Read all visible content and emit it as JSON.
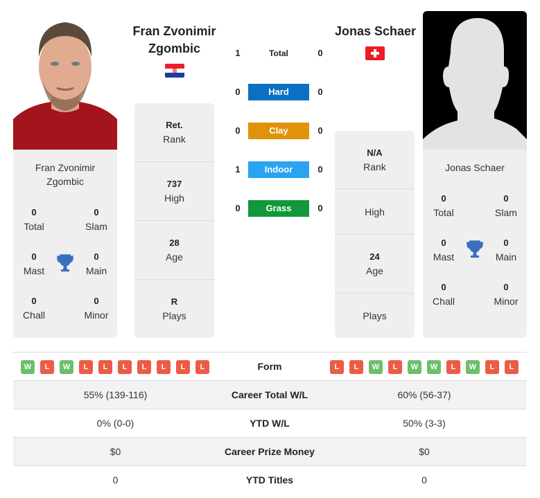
{
  "player_left": {
    "name_line1": "Fran Zvonimir",
    "name_line2": "Zgombic",
    "country": "Croatia",
    "flag_icon": "flag-croatia",
    "titles": {
      "total": "0",
      "slam": "0",
      "mast": "0",
      "main": "0",
      "chall": "0",
      "minor": "0"
    },
    "stats": {
      "rank_value": "Ret.",
      "rank_label": "Rank",
      "high_value": "737",
      "high_label": "High",
      "age_value": "28",
      "age_label": "Age",
      "plays_value": "R",
      "plays_label": "Plays"
    },
    "form": [
      "W",
      "L",
      "W",
      "L",
      "L",
      "L",
      "L",
      "L",
      "L",
      "L"
    ]
  },
  "player_right": {
    "name": "Jonas Schaer",
    "country": "Switzerland",
    "flag_icon": "flag-switzerland",
    "titles": {
      "total": "0",
      "slam": "0",
      "mast": "0",
      "main": "0",
      "chall": "0",
      "minor": "0"
    },
    "stats": {
      "rank_value": "N/A",
      "rank_label": "Rank",
      "high_value": "",
      "high_label": "High",
      "age_value": "24",
      "age_label": "Age",
      "plays_value": "",
      "plays_label": "Plays"
    },
    "form": [
      "L",
      "L",
      "W",
      "L",
      "W",
      "W",
      "L",
      "W",
      "L",
      "L"
    ]
  },
  "title_labels": {
    "total": "Total",
    "slam": "Slam",
    "mast": "Mast",
    "main": "Main",
    "chall": "Chall",
    "minor": "Minor"
  },
  "h2h": [
    {
      "label": "Total",
      "left": "1",
      "right": "0",
      "color": ""
    },
    {
      "label": "Hard",
      "left": "0",
      "right": "0",
      "color": "#0b6fc2"
    },
    {
      "label": "Clay",
      "left": "0",
      "right": "0",
      "color": "#e0920a"
    },
    {
      "label": "Indoor",
      "left": "1",
      "right": "0",
      "color": "#29a3f2"
    },
    {
      "label": "Grass",
      "left": "0",
      "right": "0",
      "color": "#11983a"
    }
  ],
  "comparison": {
    "form_label": "Form",
    "rows": [
      {
        "label": "Career Total W/L",
        "left": "55% (139-116)",
        "right": "60% (56-37)"
      },
      {
        "label": "YTD W/L",
        "left": "0% (0-0)",
        "right": "50% (3-3)"
      },
      {
        "label": "Career Prize Money",
        "left": "$0",
        "right": "$0"
      },
      {
        "label": "YTD Titles",
        "left": "0",
        "right": "0"
      }
    ]
  },
  "colors": {
    "win": "#6cbf6c",
    "loss": "#ec5b45",
    "trophy": "#3a6fbf"
  }
}
